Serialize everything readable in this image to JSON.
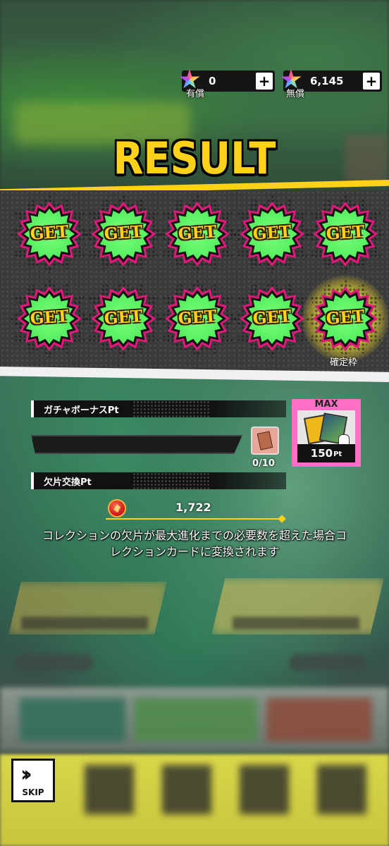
{
  "currency": {
    "paid": {
      "value": "0",
      "label": "有償",
      "icon": "gem-icon",
      "add_label": "+"
    },
    "free": {
      "value": "6,145",
      "label": "無償",
      "icon": "gem-icon",
      "add_label": "+"
    }
  },
  "result": {
    "title": "RESULT",
    "items": [
      {
        "label": "GET"
      },
      {
        "label": "GET"
      },
      {
        "label": "GET"
      },
      {
        "label": "GET"
      },
      {
        "label": "GET"
      },
      {
        "label": "GET"
      },
      {
        "label": "GET"
      },
      {
        "label": "GET"
      },
      {
        "label": "GET"
      },
      {
        "label": "GET",
        "guaranteed": true
      }
    ],
    "guaranteed_label": "確定枠"
  },
  "gacha_bonus": {
    "header": "ガチャボーナスPt",
    "progress": 0,
    "count": "0/10",
    "max_label": "MAX",
    "max_pt_value": "150",
    "max_pt_unit": "Pt"
  },
  "fragment_exchange": {
    "header": "欠片交換Pt",
    "value": "1,722",
    "notice_line1": "コレクションの欠片が最大進化までの必要数を超えた場合コ",
    "notice_line2": "レクションカードに変換されます"
  },
  "skip": {
    "label": "SKIP",
    "arrows": "››"
  },
  "colors": {
    "accent_yellow": "#ffd21a",
    "get_green": "#54ee5e",
    "burst_pink": "#e0197a",
    "max_pink": "#ff6fc8"
  }
}
